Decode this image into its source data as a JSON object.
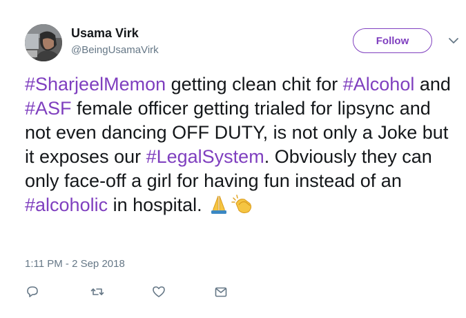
{
  "user": {
    "display_name": "Usama Virk",
    "handle": "@BeingUsamaVirk",
    "avatar_icon": "profile-photo"
  },
  "header": {
    "follow_label": "Follow",
    "menu_icon": "chevron-down-icon"
  },
  "tweet": {
    "segments": [
      {
        "text": "#SharjeelMemon",
        "type": "hashtag"
      },
      {
        "text": " getting clean chit for ",
        "type": "text"
      },
      {
        "text": "#Alcohol",
        "type": "hashtag"
      },
      {
        "text": " and ",
        "type": "text"
      },
      {
        "text": "#ASF",
        "type": "hashtag"
      },
      {
        "text": " female officer getting trialed for lipsync and not even dancing OFF DUTY, is not only a Joke but it exposes our ",
        "type": "text"
      },
      {
        "text": "#LegalSystem",
        "type": "hashtag"
      },
      {
        "text": ". Obviously they can only face-off a girl for having fun instead of an ",
        "type": "text"
      },
      {
        "text": "#alcoholic",
        "type": "hashtag"
      },
      {
        "text": " in hospital. ",
        "type": "text"
      }
    ],
    "emojis": [
      "folded-hands-emoji",
      "clapping-hands-emoji"
    ],
    "timestamp": "1:11 PM - 2 Sep 2018"
  },
  "actions": [
    "reply-icon",
    "retweet-icon",
    "like-icon",
    "direct-message-icon"
  ],
  "colors": {
    "accent": "#7f3fbf",
    "text": "#14171a",
    "muted": "#657786"
  }
}
